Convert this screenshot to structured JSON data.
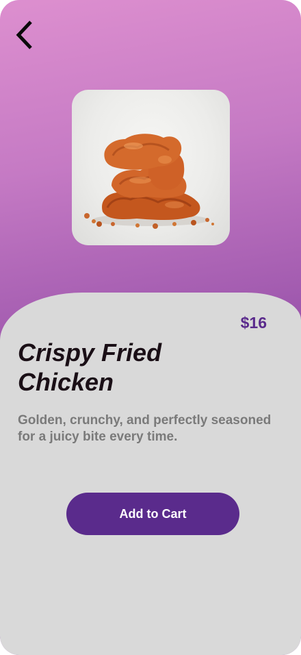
{
  "nav": {
    "back_icon": "chevron-left-icon"
  },
  "product": {
    "image_icon": "fried-chicken-image",
    "price": "$16",
    "title": "Crispy Fried Chicken",
    "description": "Golden, crunchy, and perfectly seasoned for a juicy bite every time."
  },
  "actions": {
    "add_to_cart_label": "Add to Cart"
  },
  "colors": {
    "accent": "#5a2b8c",
    "panel": "#d9d9d9",
    "gradient_top": "#dd8fcf",
    "gradient_bottom": "#8e4aa6"
  }
}
